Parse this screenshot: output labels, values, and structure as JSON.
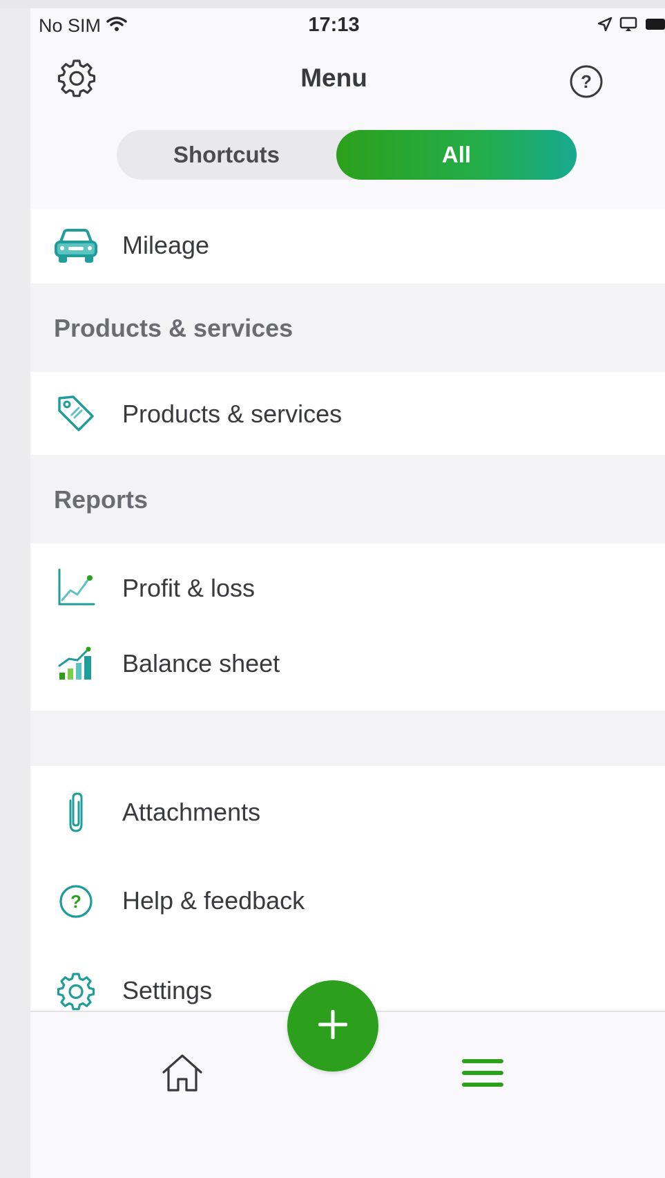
{
  "status_bar": {
    "carrier": "No SIM",
    "time": "17:13"
  },
  "header": {
    "title": "Menu",
    "settings_icon": "gear-icon",
    "help_icon": "help-circle-icon"
  },
  "segmented": {
    "shortcuts_label": "Shortcuts",
    "all_label": "All",
    "selected": "All"
  },
  "menu": {
    "mileage": {
      "label": "Mileage",
      "icon": "car-icon"
    },
    "products_section": {
      "title": "Products & services"
    },
    "products": {
      "label": "Products & services",
      "icon": "tag-icon"
    },
    "reports_section": {
      "title": "Reports"
    },
    "profit_loss": {
      "label": "Profit & loss",
      "icon": "line-chart-icon"
    },
    "balance_sheet": {
      "label": "Balance sheet",
      "icon": "bar-chart-icon"
    },
    "attachments": {
      "label": "Attachments",
      "icon": "paperclip-icon"
    },
    "help_feedback": {
      "label": "Help & feedback",
      "icon": "help-circle-icon"
    },
    "settings": {
      "label": "Settings",
      "icon": "gear-icon"
    }
  },
  "bottom_nav": {
    "home_icon": "home-icon",
    "add_icon": "plus-icon",
    "menu_icon": "hamburger-icon"
  },
  "colors": {
    "accent_green": "#2ca01c",
    "teal": "#1f9d9a",
    "section_bg": "#f3f3f5"
  }
}
